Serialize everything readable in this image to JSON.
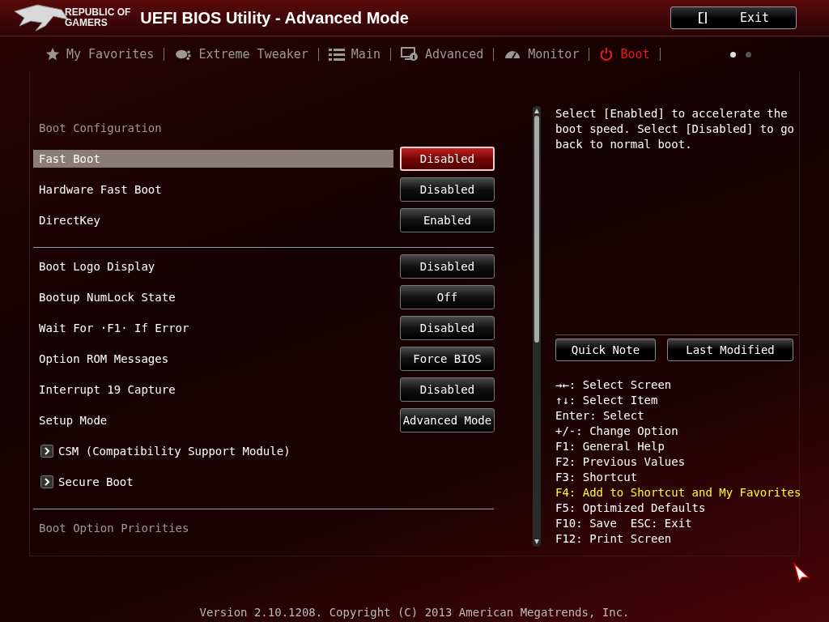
{
  "header": {
    "logo_lines": [
      "REPUBLIC OF",
      "GAMERS"
    ],
    "title": "UEFI BIOS Utility - Advanced Mode",
    "exit_button": "Exit"
  },
  "tabs": [
    {
      "label": "My Favorites",
      "kind": "star",
      "selected": false
    },
    {
      "label": "Extreme Tweaker",
      "kind": "tweaker",
      "selected": false
    },
    {
      "label": "Main",
      "kind": "list",
      "selected": false
    },
    {
      "label": "Advanced",
      "kind": "advanced",
      "selected": false
    },
    {
      "label": "Monitor",
      "kind": "monitor",
      "selected": false
    },
    {
      "label": "Boot",
      "kind": "power",
      "selected": true
    }
  ],
  "page_dots": [
    {
      "selected": true
    },
    {
      "selected": false
    }
  ],
  "settings": [
    {
      "kind": "section",
      "label": "Boot Configuration"
    },
    {
      "kind": "option",
      "label": "Fast Boot",
      "value": "Disabled",
      "selected": true
    },
    {
      "kind": "option",
      "label": "Hardware Fast Boot",
      "value": "Disabled",
      "selected": false
    },
    {
      "kind": "option",
      "label": "DirectKey",
      "value": "Enabled",
      "selected": false
    },
    {
      "kind": "divider"
    },
    {
      "kind": "option",
      "label": "Boot Logo Display",
      "value": "Disabled",
      "selected": false
    },
    {
      "kind": "option",
      "label": "Bootup NumLock State",
      "value": "Off",
      "selected": false
    },
    {
      "kind": "option",
      "label": "Wait For ·F1· If Error",
      "value": "Disabled",
      "selected": false
    },
    {
      "kind": "option",
      "label": "Option ROM Messages",
      "value": "Force BIOS",
      "selected": false
    },
    {
      "kind": "option",
      "label": "Interrupt 19 Capture",
      "value": "Disabled",
      "selected": false
    },
    {
      "kind": "option",
      "label": "Setup Mode",
      "value": "Advanced Mode",
      "selected": false
    },
    {
      "kind": "submenu",
      "label": "CSM (Compatibility Support Module)"
    },
    {
      "kind": "submenu",
      "label": "Secure Boot"
    },
    {
      "kind": "divider"
    },
    {
      "kind": "section",
      "label": "Boot Option Priorities"
    }
  ],
  "help_text": "Select [Enabled] to accelerate the boot speed. Select [Disabled] to go back to normal boot.",
  "buttons": [
    "Quick Note",
    "Last Modified"
  ],
  "key_hints": [
    {
      "text": "→←: Select Screen",
      "highlighted": false
    },
    {
      "text": "↑↓: Select Item",
      "highlighted": false
    },
    {
      "text": "Enter: Select",
      "highlighted": false
    },
    {
      "text": "+/-: Change Option",
      "highlighted": false
    },
    {
      "text": "F1: General Help",
      "highlighted": false
    },
    {
      "text": "F2: Previous Values",
      "highlighted": false
    },
    {
      "text": "F3: Shortcut",
      "highlighted": false
    },
    {
      "text": "F4: Add to Shortcut and My Favorites",
      "highlighted": true
    },
    {
      "text": "F5: Optimized Defaults",
      "highlighted": false
    },
    {
      "text": "F10: Save  ESC: Exit",
      "highlighted": false
    },
    {
      "text": "F12: Print Screen",
      "highlighted": false
    }
  ],
  "footer": "Version 2.10.1208. Copyright (C) 2013 American Megatrends, Inc."
}
